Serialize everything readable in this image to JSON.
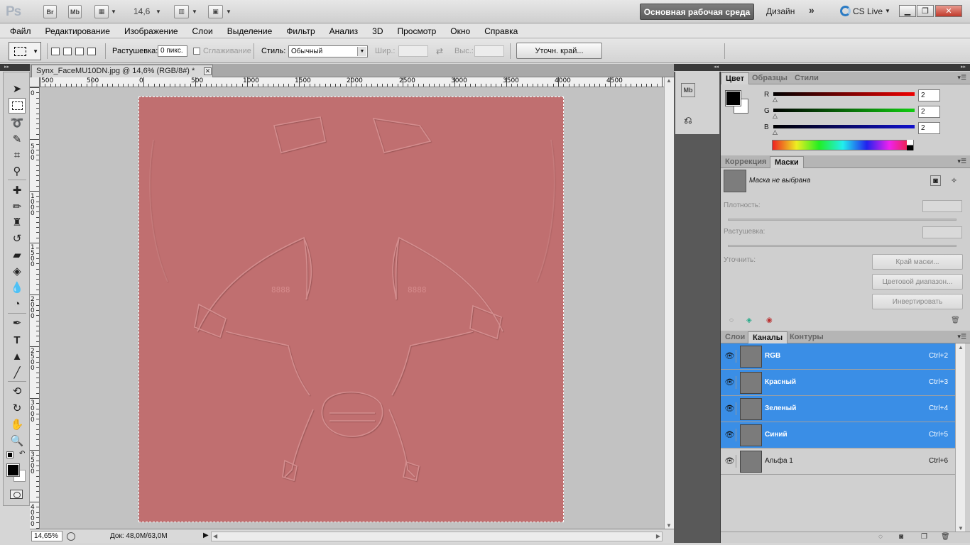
{
  "app": {
    "logo": "Ps",
    "bridge_btn": "Br",
    "minibridge_btn": "Mb",
    "zoom": "14,6",
    "workspace": "Основная рабочая среда",
    "design": "Дизайн",
    "more": "»",
    "cslive": "CS Live"
  },
  "menu": [
    "Файл",
    "Редактирование",
    "Изображение",
    "Слои",
    "Выделение",
    "Фильтр",
    "Анализ",
    "3D",
    "Просмотр",
    "Окно",
    "Справка"
  ],
  "options": {
    "feather_label": "Растушевка:",
    "feather_value": "0 пикс.",
    "antialias_label": "Сглаживание",
    "style_label": "Стиль:",
    "style_value": "Обычный",
    "width_label": "Шир.:",
    "height_label": "Выс.:",
    "refine_edge": "Уточн. край..."
  },
  "document": {
    "tab_title": "Synx_FaceMU10DN.jpg @ 14,6% (RGB/8#) *",
    "zoom_field": "14,65%",
    "doc_info": "Док: 48,0M/63,0M",
    "ruler_h_labels": [
      "500",
      "0",
      "500",
      "1000",
      "1500",
      "2000",
      "2500",
      "3000",
      "3500",
      "4000",
      "4500"
    ],
    "ruler_v_labels": [
      "0",
      "5 0 0",
      "1 0 0 0",
      "1 5 0 0",
      "2 0 0 0",
      "2 5 0 0",
      "3 0 0 0",
      "3 5 0 0",
      "4 0 0 0"
    ],
    "canvas_color": "#c06f70",
    "glyphs_left": "8888",
    "glyphs_right": "8888"
  },
  "color_panel": {
    "tabs": [
      "Цвет",
      "Образцы",
      "Стили"
    ],
    "channels": [
      {
        "label": "R",
        "value": "2"
      },
      {
        "label": "G",
        "value": "2"
      },
      {
        "label": "B",
        "value": "2"
      }
    ]
  },
  "masks_panel": {
    "tabs": [
      "Коррекция",
      "Маски"
    ],
    "no_mask": "Маска не выбрана",
    "density": "Плотность:",
    "feather": "Растушевка:",
    "refine": "Уточнить:",
    "btn_mask_edge": "Край маски...",
    "btn_color_range": "Цветовой диапазон...",
    "btn_invert": "Инвертировать"
  },
  "channels_panel": {
    "tabs": [
      "Слои",
      "Каналы",
      "Контуры"
    ],
    "rows": [
      {
        "name": "RGB",
        "shortcut": "Ctrl+2"
      },
      {
        "name": "Красный",
        "shortcut": "Ctrl+3"
      },
      {
        "name": "Зеленый",
        "shortcut": "Ctrl+4"
      },
      {
        "name": "Синий",
        "shortcut": "Ctrl+5"
      },
      {
        "name": "Альфа 1",
        "shortcut": "Ctrl+6"
      }
    ]
  }
}
